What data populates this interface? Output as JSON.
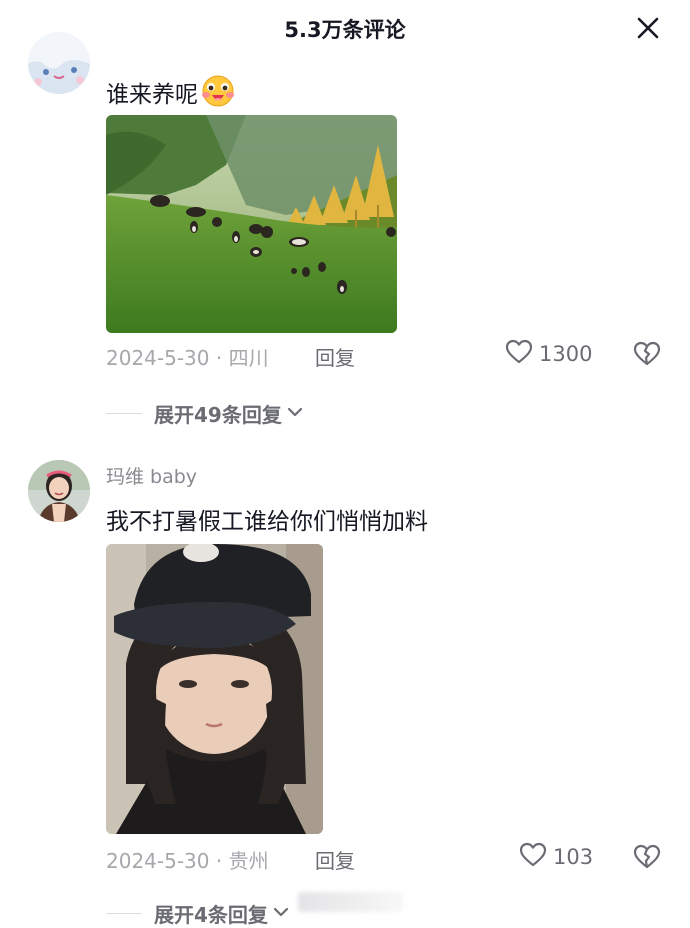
{
  "header": {
    "title": "5.3万条评论",
    "close_icon": "close-icon"
  },
  "comments": [
    {
      "username": "",
      "text": "谁来养呢",
      "emoji_icon": "blush-face-emoji-icon",
      "image": "meadow-with-grazing-yaks-photo",
      "date_location": "2024-5-30 · 四川",
      "reply_label": "回复",
      "likes": "1300",
      "expand_label": "展开49条回复"
    },
    {
      "username": "玛维 baby",
      "text": "我不打暑假工谁给你们悄悄加料",
      "image": "girl-in-black-cap-selfie-photo",
      "date_location": "2024-5-30 · 贵州",
      "reply_label": "回复",
      "likes": "103",
      "expand_label": "展开4条回复"
    }
  ],
  "colors": {
    "primary_text": "#161823",
    "secondary_text": "#8a8b91",
    "meta_text": "#a7a8ad",
    "action_text": "#6b6c73"
  }
}
